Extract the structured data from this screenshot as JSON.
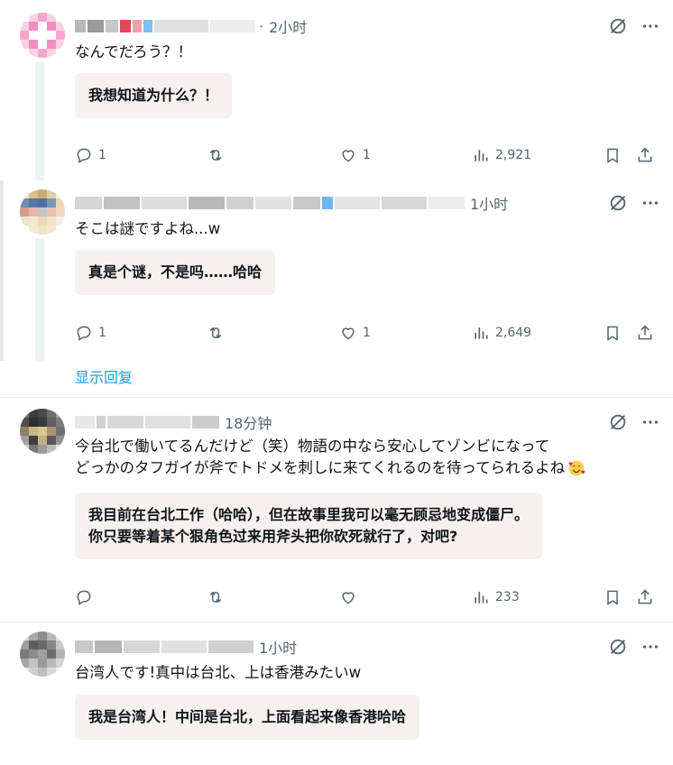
{
  "replies": [
    {
      "time": "2小时",
      "original_text": "なんでだろう？！",
      "translation": "我想知道为什么？！",
      "replies_count": "1",
      "retweets_count": "",
      "likes_count": "1",
      "views_count": "2,921"
    },
    {
      "time": "1小时",
      "original_text": "そこは謎ですよね...w",
      "translation": "真是个谜，不是吗……哈哈",
      "replies_count": "1",
      "retweets_count": "",
      "likes_count": "1",
      "views_count": "2,649"
    },
    {
      "time": "18分钟",
      "original_text_line1": "今台北で働いてるんだけど（笑）物語の中なら安心してゾンビになって",
      "original_text_line2": "どっかのタフガイが斧でトドメを刺しに来てくれるのを待ってられるよね",
      "translation_line1": "我目前在台北工作（哈哈），但在故事里我可以毫无顾忌地变成僵尸。",
      "translation_line2": "你只要等着某个狠角色过来用斧头把你砍死就行了，对吧?",
      "replies_count": "",
      "retweets_count": "",
      "likes_count": "",
      "views_count": "233"
    },
    {
      "time": "1小时",
      "original_text": "台湾人です!真中は台北、上は香港みたいw",
      "translation": "我是台湾人！中间是台北，上面看起来像香港哈哈"
    }
  ],
  "show_replies_label": "显示回复",
  "colors": {
    "accent": "#1d9bf0",
    "muted": "#536471",
    "translation_bg": "#f7f0ef",
    "emoji_face": "#ffcc4d"
  },
  "icons": [
    "reply-icon",
    "retweet-icon",
    "like-icon",
    "views-icon",
    "bookmark-icon",
    "share-icon",
    "grok-icon",
    "more-icon",
    "smiling-face-with-hearts-emoji"
  ]
}
